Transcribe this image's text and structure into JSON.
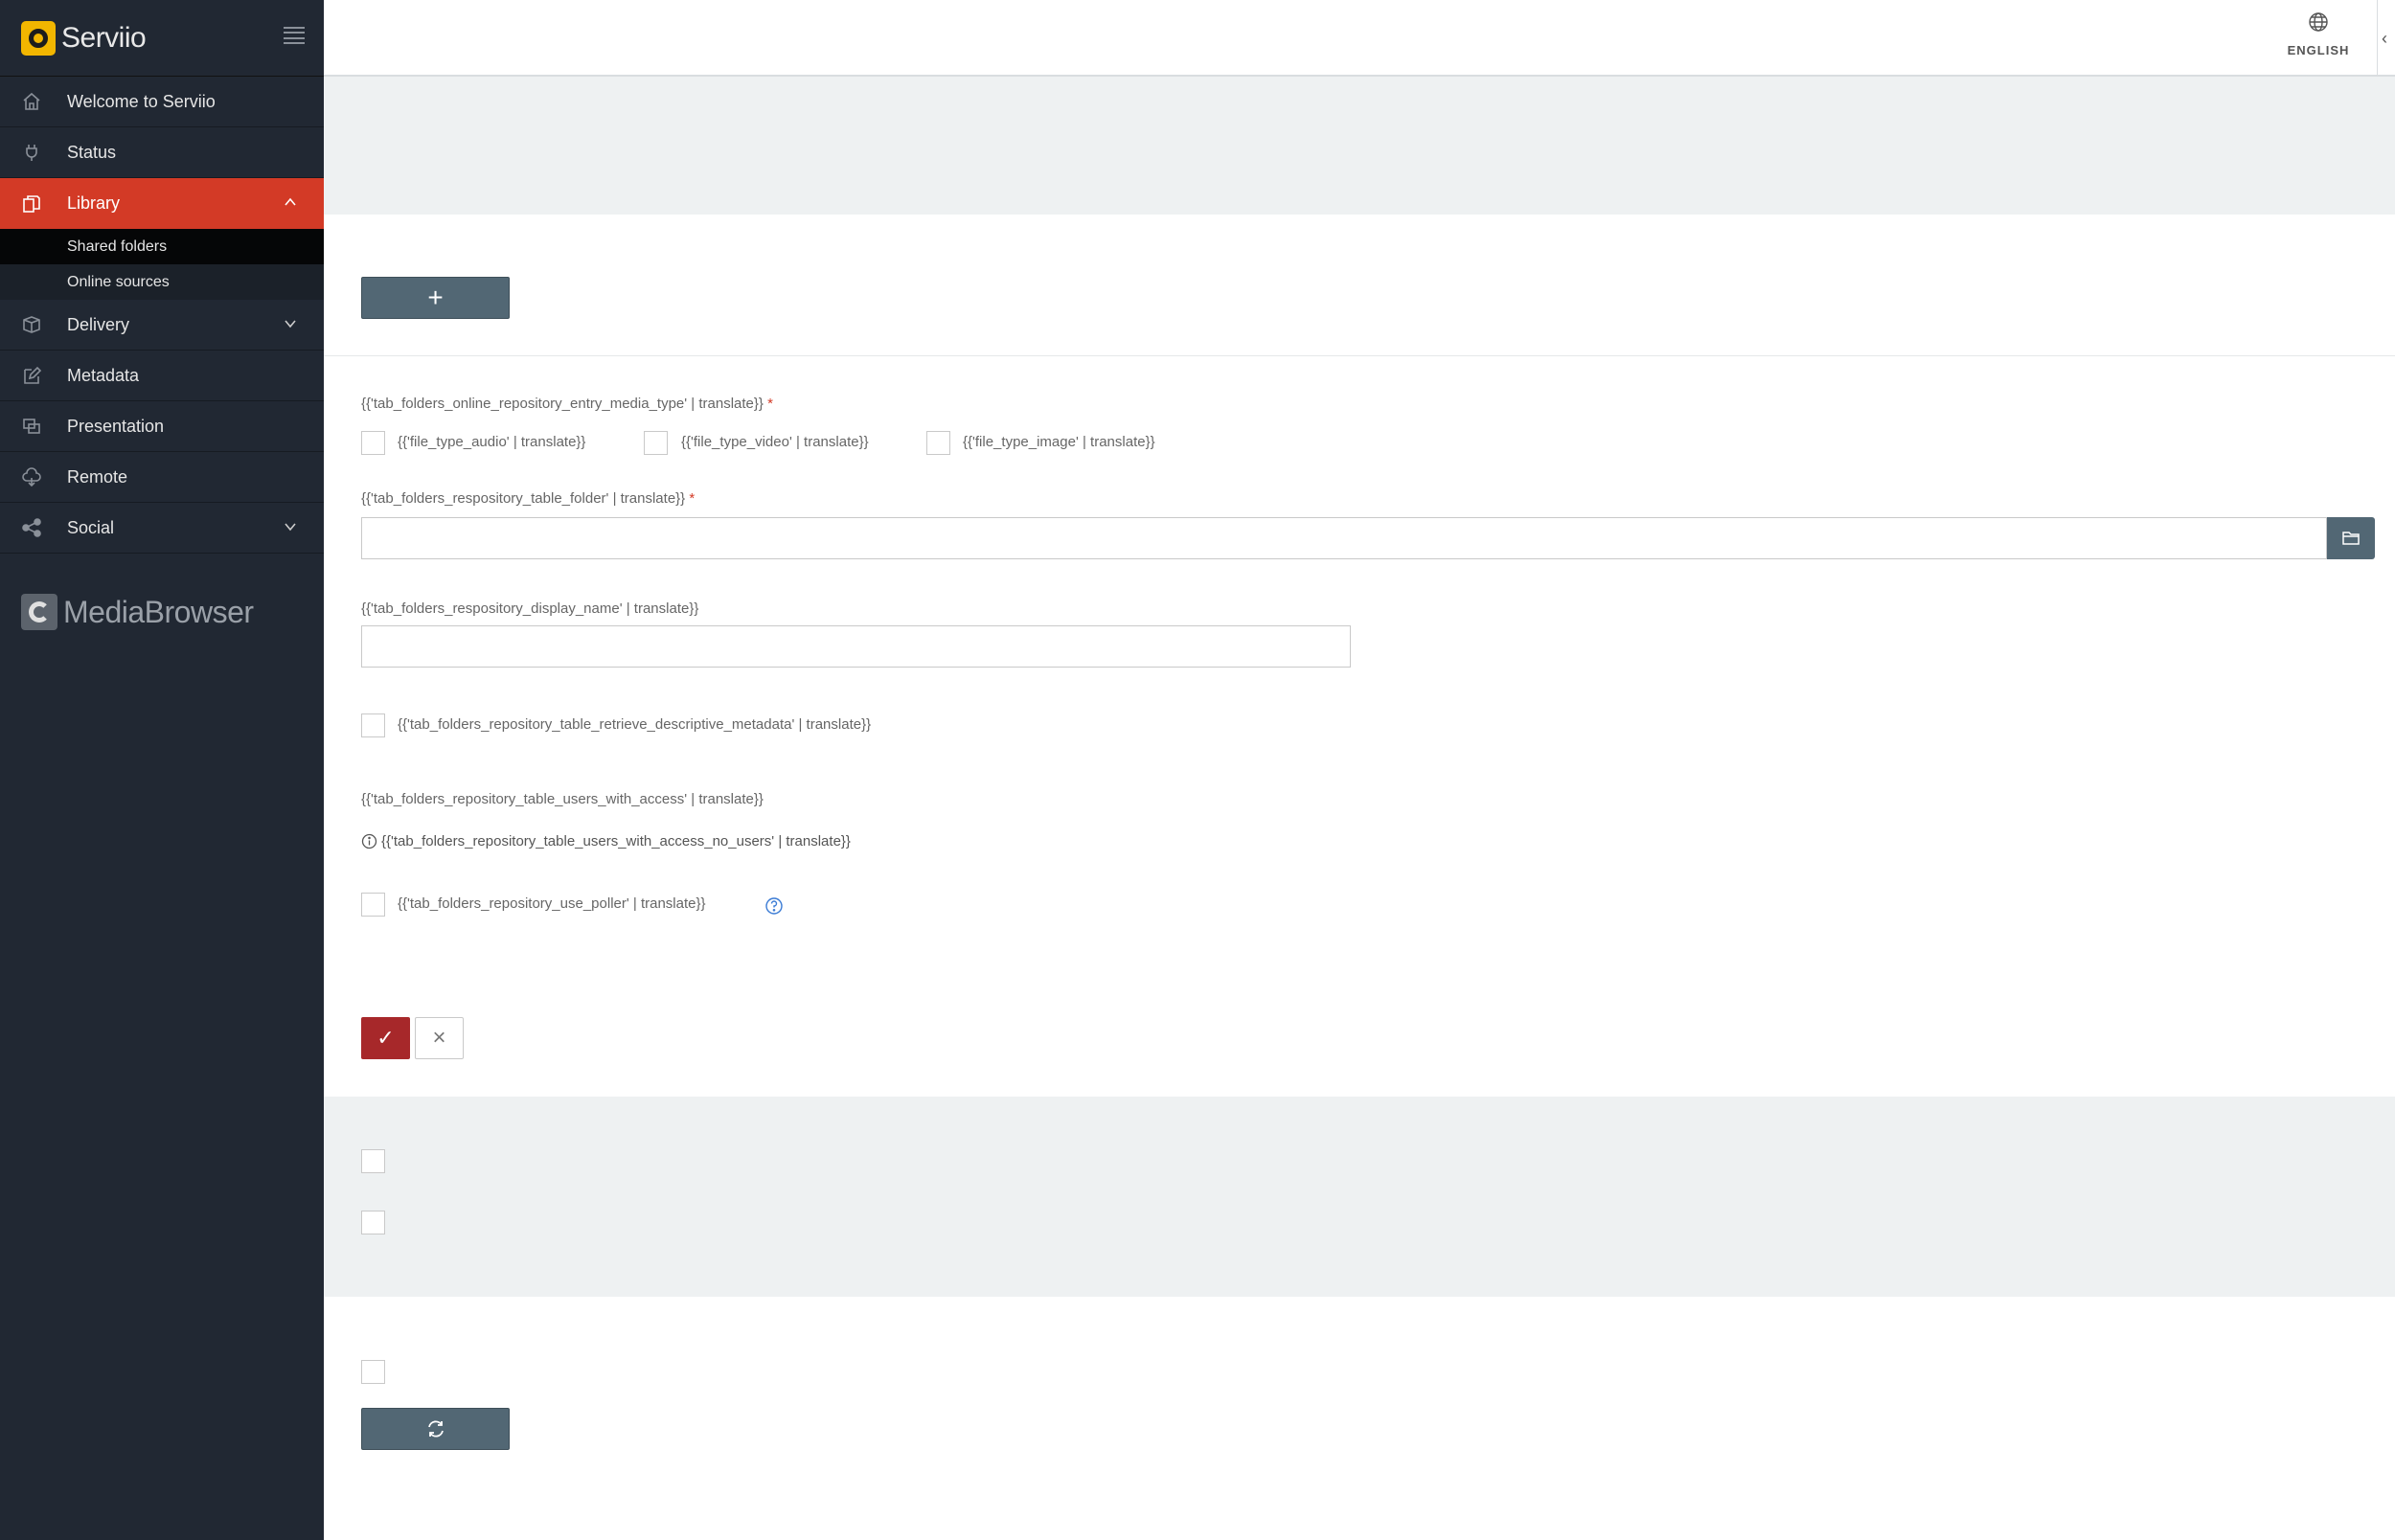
{
  "brand": {
    "name": "Serviio"
  },
  "sidebar": {
    "items": [
      {
        "label": "Welcome to Serviio",
        "icon": "home-icon"
      },
      {
        "label": "Status",
        "icon": "plug-icon"
      },
      {
        "label": "Library",
        "icon": "library-icon",
        "active": true,
        "expanded": true
      },
      {
        "label": "Delivery",
        "icon": "box-icon",
        "expandable": true
      },
      {
        "label": "Metadata",
        "icon": "edit-icon"
      },
      {
        "label": "Presentation",
        "icon": "presentation-icon"
      },
      {
        "label": "Remote",
        "icon": "cloud-icon"
      },
      {
        "label": "Social",
        "icon": "share-icon",
        "expandable": true
      }
    ],
    "library_sub": [
      {
        "label": "Shared folders",
        "selected": true
      },
      {
        "label": "Online sources",
        "selected": false
      }
    ],
    "footer_logo": "MediaBrowser"
  },
  "topbar": {
    "language": "ENGLISH"
  },
  "form": {
    "media_type_label": "{{'tab_folders_online_repository_entry_media_type' | translate}}",
    "required_mark": "*",
    "types": [
      {
        "label": "{{'file_type_audio' | translate}}",
        "checked": false
      },
      {
        "label": "{{'file_type_video' | translate}}",
        "checked": false
      },
      {
        "label": "{{'file_type_image' | translate}}",
        "checked": false
      }
    ],
    "folder_label": "{{'tab_folders_respository_table_folder' | translate}}",
    "folder_value": "",
    "display_name_label": "{{'tab_folders_respository_display_name' | translate}}",
    "display_name_value": "",
    "retrieve_metadata_label": "{{'tab_folders_repository_table_retrieve_descriptive_metadata' | translate}}",
    "users_with_access_label": "{{'tab_folders_repository_table_users_with_access' | translate}}",
    "no_users_label": "{{'tab_folders_repository_table_users_with_access_no_users' | translate}}",
    "use_poller_label": "{{'tab_folders_repository_use_poller' | translate}}"
  },
  "colors": {
    "sidebar_bg": "#212833",
    "active_red": "#d33a26",
    "button_slate": "#526774",
    "save_red": "#a7282a",
    "gray_band": "#eef1f2"
  }
}
